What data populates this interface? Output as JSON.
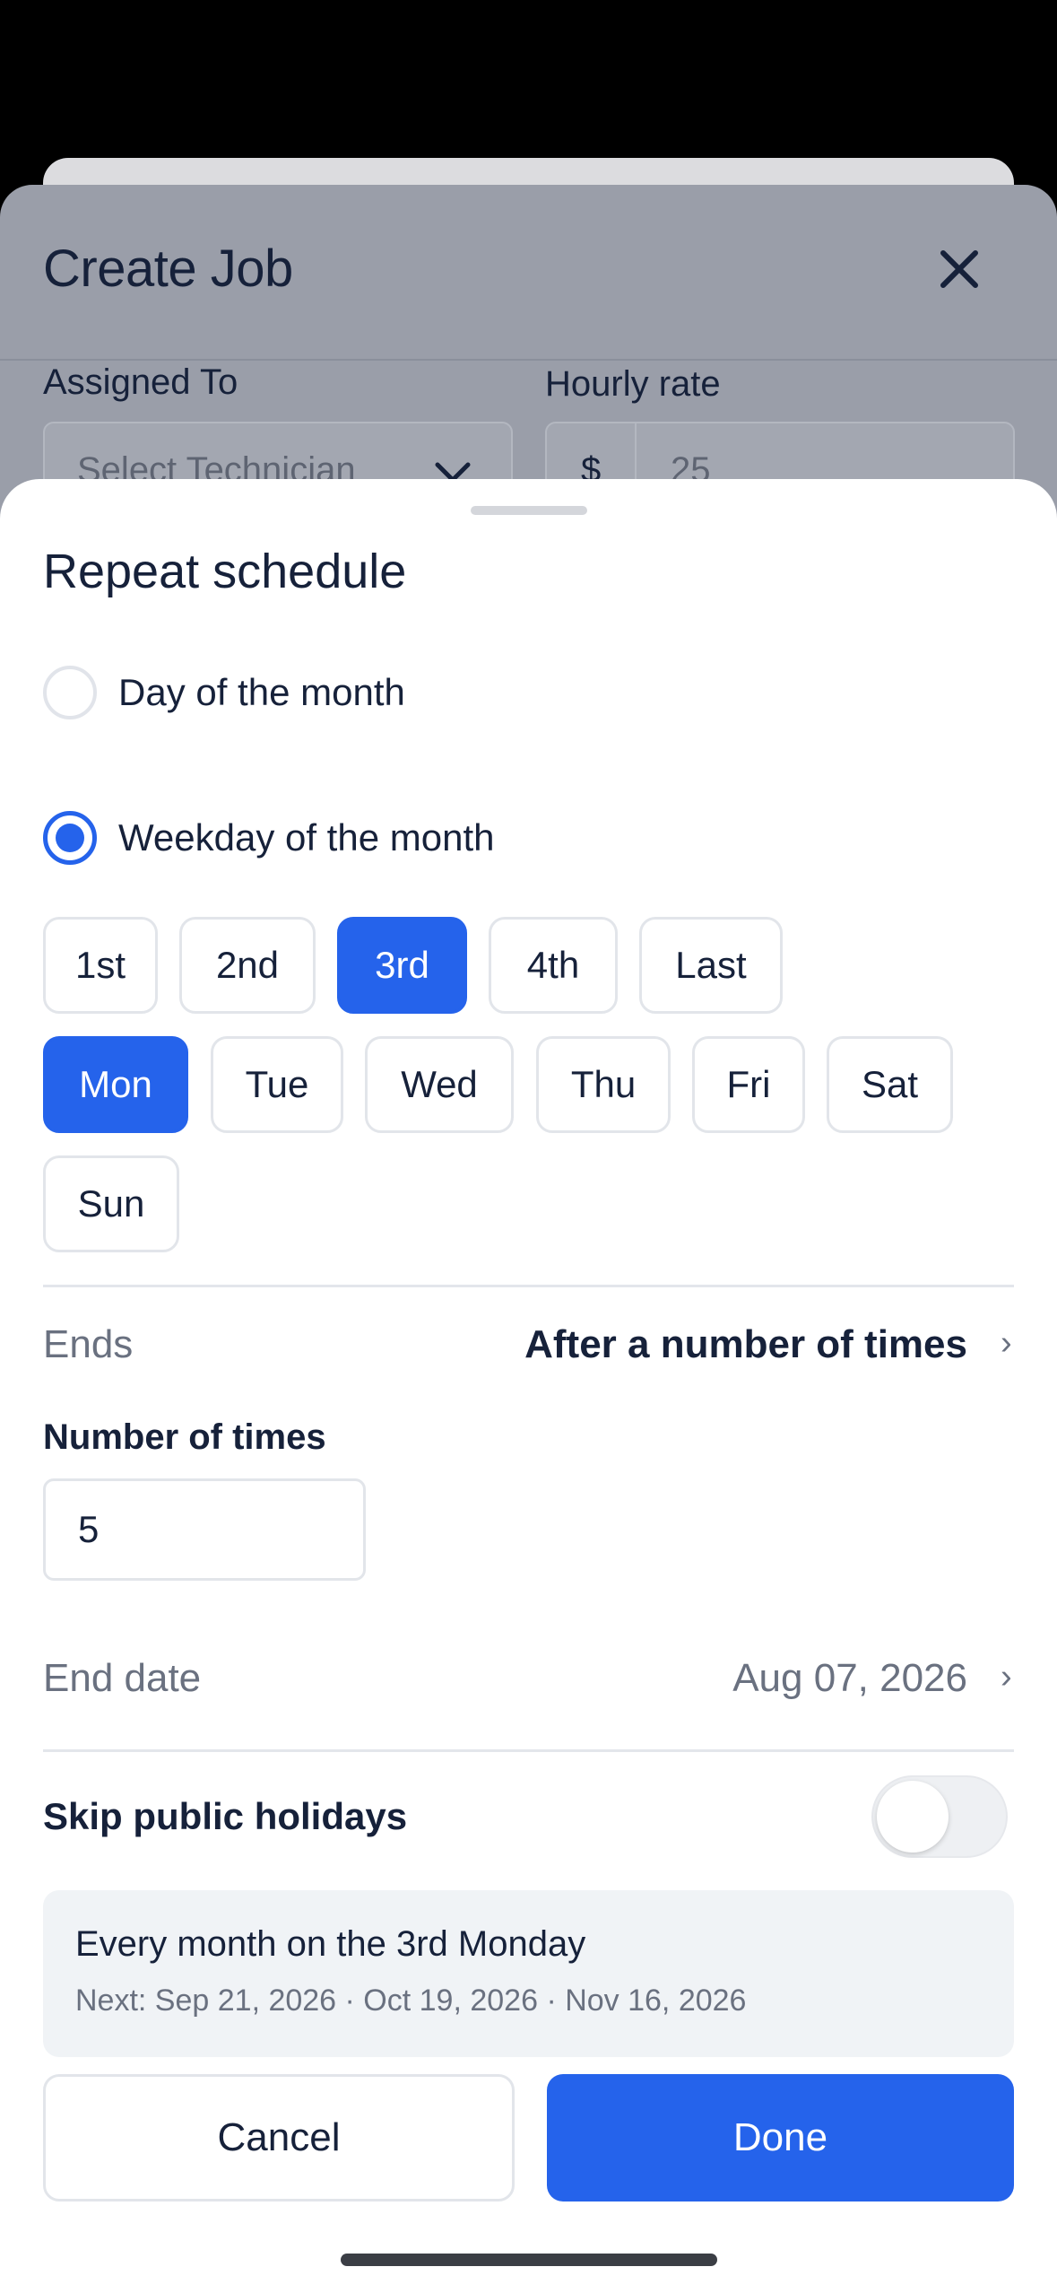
{
  "background": {
    "title": "Create Job",
    "assigned_label": "Assigned To",
    "assigned_placeholder": "Select Technician",
    "rate_label": "Hourly rate",
    "rate_currency": "$",
    "rate_value": "25"
  },
  "sheet": {
    "title": "Repeat schedule",
    "options": [
      {
        "label": "Day of the month",
        "selected": false
      },
      {
        "label": "Weekday of the month",
        "selected": true
      }
    ],
    "ordinals": [
      {
        "label": "1st",
        "selected": false
      },
      {
        "label": "2nd",
        "selected": false
      },
      {
        "label": "3rd",
        "selected": true
      },
      {
        "label": "4th",
        "selected": false
      },
      {
        "label": "Last",
        "selected": false
      }
    ],
    "weekdays": [
      {
        "label": "Mon",
        "selected": true
      },
      {
        "label": "Tue",
        "selected": false
      },
      {
        "label": "Wed",
        "selected": false
      },
      {
        "label": "Thu",
        "selected": false
      },
      {
        "label": "Fri",
        "selected": false
      },
      {
        "label": "Sat",
        "selected": false
      },
      {
        "label": "Sun",
        "selected": false
      }
    ],
    "ends": {
      "label": "Ends",
      "value": "After a number of times"
    },
    "number_of_times": {
      "label": "Number of times",
      "value": "5"
    },
    "end_date": {
      "label": "End date",
      "value": "Aug 07, 2026"
    },
    "skip_holidays": {
      "label": "Skip public holidays",
      "enabled": false
    },
    "summary": {
      "title": "Every month on the 3rd Monday",
      "next": "Next: Sep 21, 2026 · Oct 19, 2026 · Nov 16, 2026"
    },
    "cancel_label": "Cancel",
    "done_label": "Done"
  },
  "colors": {
    "accent": "#2563eb",
    "text": "#16213a",
    "muted": "#6a7180"
  }
}
